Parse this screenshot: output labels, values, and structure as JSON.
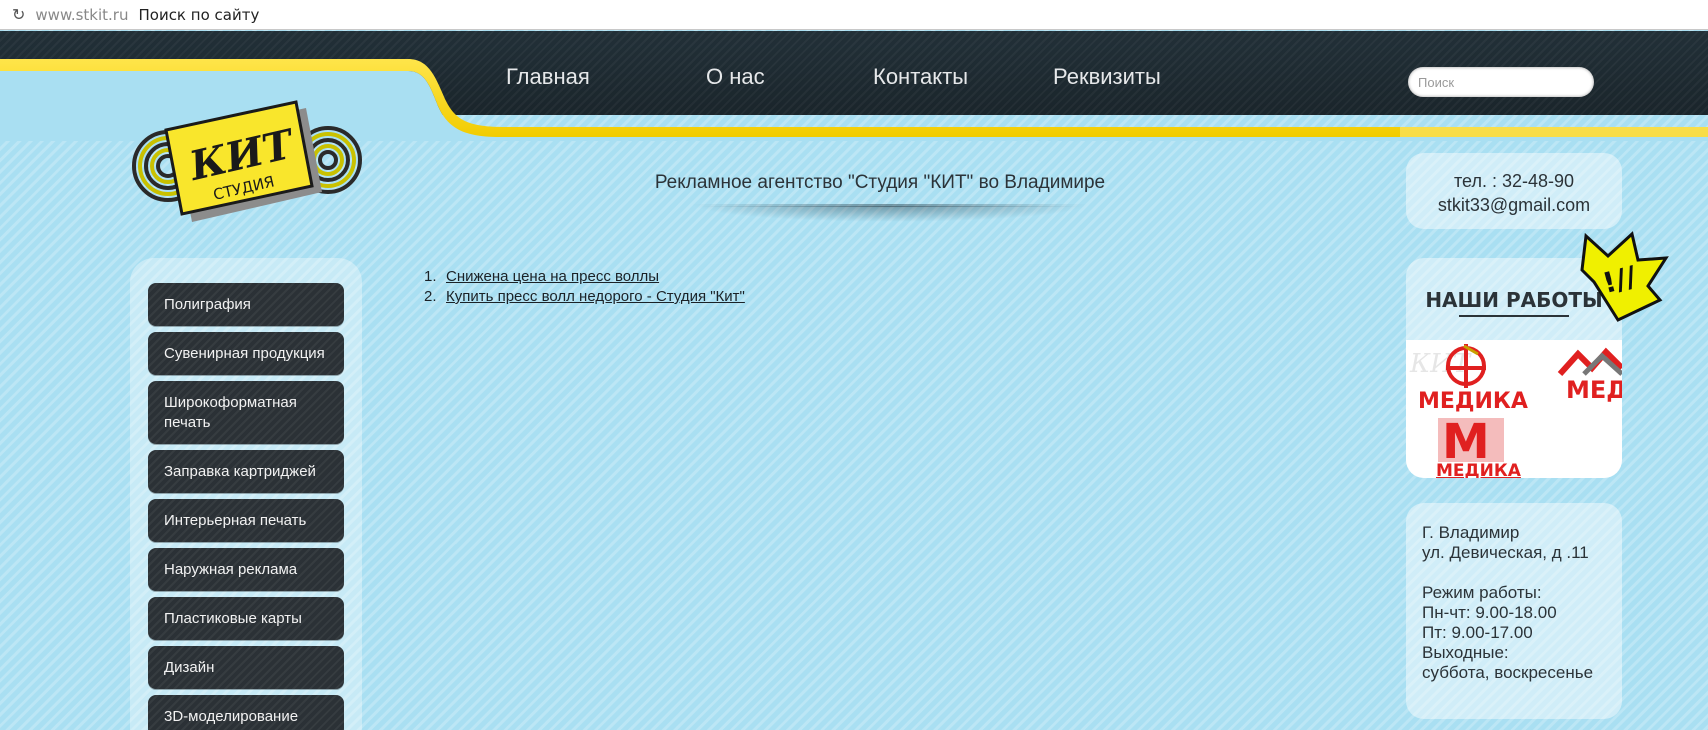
{
  "browser": {
    "host": "www.stkit.ru",
    "query": "Поиск по сайту"
  },
  "nav": {
    "items": [
      {
        "label": "Главная"
      },
      {
        "label": "О нас"
      },
      {
        "label": "Контакты"
      },
      {
        "label": "Реквизиты"
      }
    ]
  },
  "search": {
    "placeholder": "Поиск"
  },
  "logo": {
    "line1": "КИТ",
    "line2": "СТУДИЯ"
  },
  "title": "Рекламное агентство \"Студия \"КИТ\" во Владимире",
  "articles": [
    {
      "num": "1.",
      "label": "Снижена цена на пресс воллы"
    },
    {
      "num": "2.",
      "label": "Купить пресс волл недорого - Студия \"Кит\""
    }
  ],
  "sidebar": {
    "items": [
      {
        "label": "Полиграфия"
      },
      {
        "label": "Сувенирная продукция"
      },
      {
        "label": "Широкоформатная печать"
      },
      {
        "label": "Заправка картриджей"
      },
      {
        "label": "Интерьерная печать"
      },
      {
        "label": "Наружная реклама"
      },
      {
        "label": "Пластиковые карты"
      },
      {
        "label": "Дизайн"
      },
      {
        "label": "3D-моделирование"
      }
    ]
  },
  "contacts": {
    "phone": "тел. : 32-48-90",
    "email": "stkit33@gmail.com"
  },
  "works": {
    "title": "НАШИ РАБОТЫ",
    "burst_text": "!//",
    "logo_a": "МЕДИКА",
    "logo_b": "МЕД",
    "logo_c": "МЕДИКА",
    "logo_mark": "М"
  },
  "address": {
    "city": "Г. Владимир",
    "street": "ул. Девическая, д .11",
    "hours_title": "Режим работы:",
    "hours_1": "Пн-чт: 9.00-18.00",
    "hours_2": "Пт: 9.00-17.00",
    "weekend_title": "Выходные:",
    "weekend": "суббота, воскресенье"
  },
  "colors": {
    "background": "#a9dff2",
    "header": "#1a252b",
    "accent": "#f7d800",
    "menu": "#2b3136"
  }
}
